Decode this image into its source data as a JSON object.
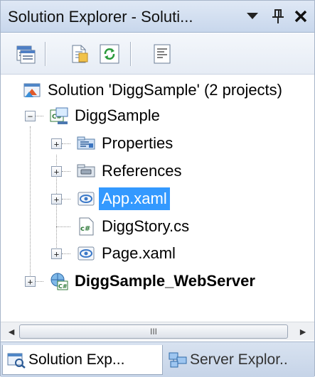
{
  "window": {
    "title": "Solution Explorer - Soluti...",
    "dropdown_glyph": "▼",
    "pin_icon": "pin-icon",
    "close_glyph": "✕"
  },
  "toolbar": {
    "items": [
      "properties-icon",
      "show-all-files-icon",
      "refresh-icon",
      "view-code-icon"
    ]
  },
  "tree": {
    "solution": "Solution 'DiggSample' (2 projects)",
    "project": "DiggSample",
    "items": [
      {
        "label": "Properties",
        "icon": "properties-folder-icon",
        "expandable": true
      },
      {
        "label": "References",
        "icon": "references-folder-icon",
        "expandable": true
      },
      {
        "label": "App.xaml",
        "icon": "xaml-file-icon",
        "expandable": true,
        "selected": true
      },
      {
        "label": "DiggStory.cs",
        "icon": "csharp-file-icon",
        "expandable": false
      },
      {
        "label": "Page.xaml",
        "icon": "xaml-file-icon",
        "expandable": true
      }
    ],
    "web_project": "DiggSample_WebServer",
    "expand_glyph": "+",
    "collapse_glyph": "−"
  },
  "scrollbar": {
    "left_arrow": "◄",
    "right_arrow": "►",
    "grip": "III"
  },
  "tabs": [
    {
      "label": "Solution Exp...",
      "active": true
    },
    {
      "label": "Server Explor..",
      "active": false
    }
  ],
  "colors": {
    "selection": "#3399ff",
    "titlebar": "#c8d7ec"
  }
}
